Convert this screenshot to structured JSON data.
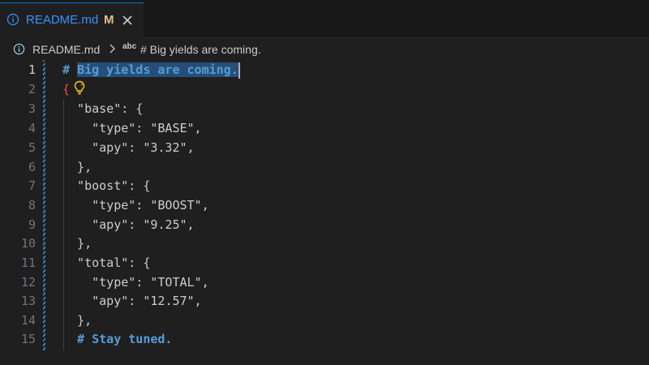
{
  "tab": {
    "filename": "README.md",
    "modified_badge": "M",
    "icons": [
      "info-icon",
      "close-icon"
    ]
  },
  "breadcrumb": {
    "file": "README.md",
    "symbol_kind": "abc",
    "symbol": "# Big yields are coming."
  },
  "editor": {
    "active_line": 1,
    "lines": [
      {
        "num": "1",
        "text": "# Big yields are coming."
      },
      {
        "num": "2",
        "text": "{"
      },
      {
        "num": "3",
        "text": "  \"base\": {"
      },
      {
        "num": "4",
        "text": "    \"type\": \"BASE\","
      },
      {
        "num": "5",
        "text": "    \"apy\": \"3.32\","
      },
      {
        "num": "6",
        "text": "  },"
      },
      {
        "num": "7",
        "text": "  \"boost\": {"
      },
      {
        "num": "8",
        "text": "    \"type\": \"BOOST\","
      },
      {
        "num": "9",
        "text": "    \"apy\": \"9.25\","
      },
      {
        "num": "10",
        "text": "  },"
      },
      {
        "num": "11",
        "text": "  \"total\": {"
      },
      {
        "num": "12",
        "text": "    \"type\": \"TOTAL\","
      },
      {
        "num": "13",
        "text": "    \"apy\": \"12.57\","
      },
      {
        "num": "14",
        "text": "  },"
      },
      {
        "num": "15",
        "text": "  # Stay tuned."
      }
    ],
    "heading_hash": "#",
    "heading_text": "Big yields are coming.",
    "open_brace": "{",
    "comment_text": "# Stay tuned."
  },
  "colors": {
    "accent": "#0078d4",
    "tab_label": "#3794ff",
    "modified": "#e2c08d",
    "markdown_heading": "#569cd6",
    "selection": "#264f78",
    "brace_error": "#f44747",
    "lightbulb": "#ffcc00"
  }
}
